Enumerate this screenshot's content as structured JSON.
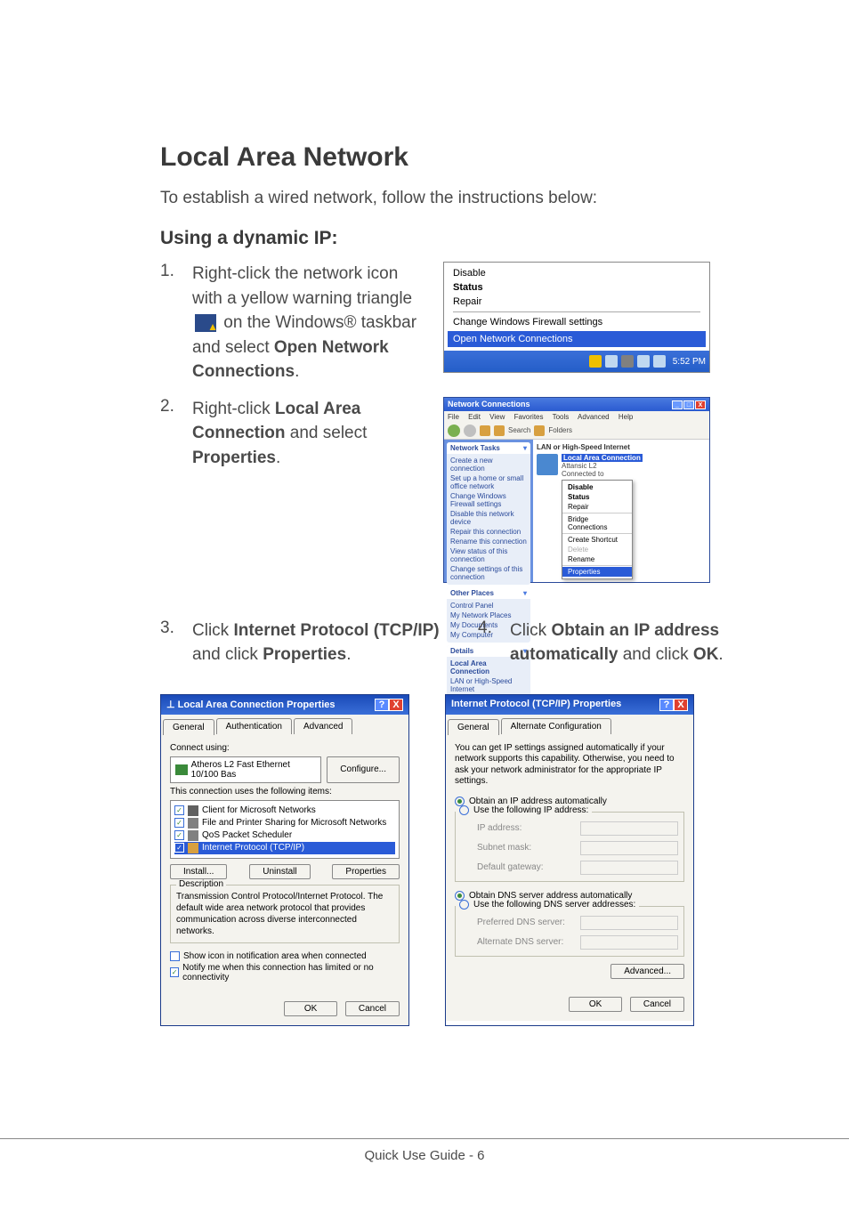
{
  "heading": "Local Area Network",
  "intro": "To establish a wired network, follow the instructions below:",
  "subheading": "Using a dynamic IP:",
  "steps": {
    "s1_p1": "Right-click the network icon with a yellow warning triangle ",
    "s1_p2": " on the Windows® taskbar and select ",
    "s1_b1": "Open Network Connections",
    "s1_end": ".",
    "s2_p1": "Right-click ",
    "s2_b1": "Local Area Connection",
    "s2_p2": " and select ",
    "s2_b2": "Properties",
    "s2_end": ".",
    "s3_p1": "Click ",
    "s3_b1": "Internet Protocol (TCP/IP)",
    "s3_p2": " and click ",
    "s3_b2": "Properties",
    "s3_end": ".",
    "s4_p1": "Click ",
    "s4_b1": "Obtain an IP address automatically",
    "s4_p2": " and click ",
    "s4_b2": "OK",
    "s4_end": "."
  },
  "nums": {
    "n1": "1.",
    "n2": "2.",
    "n3": "3.",
    "n4": "4."
  },
  "shot1": {
    "disable": "Disable",
    "status": "Status",
    "repair": "Repair",
    "firewall": "Change Windows Firewall settings",
    "open": "Open Network Connections",
    "time": "5:52 PM"
  },
  "shot2": {
    "title": "Network Connections",
    "menu": {
      "file": "File",
      "edit": "Edit",
      "view": "View",
      "favorites": "Favorites",
      "tools": "Tools",
      "advanced": "Advanced",
      "help": "Help"
    },
    "toolbar": {
      "search": "Search",
      "folders": "Folders"
    },
    "tasks_hd": "Network Tasks",
    "tasks": {
      "t1": "Create a new connection",
      "t2": "Set up a home or small office network",
      "t3": "Change Windows Firewall settings",
      "t4": "Disable this network device",
      "t5": "Repair this connection",
      "t6": "Rename this connection",
      "t7": "View status of this connection",
      "t8": "Change settings of this connection"
    },
    "places_hd": "Other Places",
    "places": {
      "p1": "Control Panel",
      "p2": "My Network Places",
      "p3": "My Documents",
      "p4": "My Computer"
    },
    "details_hd": "Details",
    "details": {
      "d1": "Local Area Connection",
      "d2": "LAN or High-Speed Internet"
    },
    "section": "LAN or High-Speed Internet",
    "item": {
      "name": "Local Area Connection",
      "line2": "Attansic L2",
      "line3": "Connected to"
    },
    "ctx": {
      "disable": "Disable",
      "status": "Status",
      "repair": "Repair",
      "bridge": "Bridge Connections",
      "shortcut": "Create Shortcut",
      "delete": "Delete",
      "rename": "Rename",
      "properties": "Properties"
    }
  },
  "shot3": {
    "title": "Local Area Connection Properties",
    "tabs": {
      "general": "General",
      "auth": "Authentication",
      "adv": "Advanced"
    },
    "connect_using": "Connect using:",
    "nic": "Atheros L2 Fast Ethernet 10/100 Bas",
    "configure": "Configure...",
    "uses_items": "This connection uses the following items:",
    "items": {
      "i1": "Client for Microsoft Networks",
      "i2": "File and Printer Sharing for Microsoft Networks",
      "i3": "QoS Packet Scheduler",
      "i4": "Internet Protocol (TCP/IP)"
    },
    "install": "Install...",
    "uninstall": "Uninstall",
    "properties": "Properties",
    "desc_hd": "Description",
    "desc": "Transmission Control Protocol/Internet Protocol. The default wide area network protocol that provides communication across diverse interconnected networks.",
    "show_icon": "Show icon in notification area when connected",
    "notify": "Notify me when this connection has limited or no connectivity",
    "ok": "OK",
    "cancel": "Cancel"
  },
  "shot4": {
    "title": "Internet Protocol (TCP/IP) Properties",
    "tabs": {
      "general": "General",
      "alt": "Alternate Configuration"
    },
    "info": "You can get IP settings assigned automatically if your network supports this capability. Otherwise, you need to ask your network administrator for the appropriate IP settings.",
    "obtain_ip": "Obtain an IP address automatically",
    "use_ip": "Use the following IP address:",
    "ip_addr": "IP address:",
    "subnet": "Subnet mask:",
    "gateway": "Default gateway:",
    "obtain_dns": "Obtain DNS server address automatically",
    "use_dns": "Use the following DNS server addresses:",
    "pref_dns": "Preferred DNS server:",
    "alt_dns": "Alternate DNS server:",
    "advanced": "Advanced...",
    "ok": "OK",
    "cancel": "Cancel"
  },
  "footer": "Quick Use Guide - 6",
  "sym": {
    "help": "?",
    "close": "X",
    "chev": "▾",
    "check": "✓"
  }
}
